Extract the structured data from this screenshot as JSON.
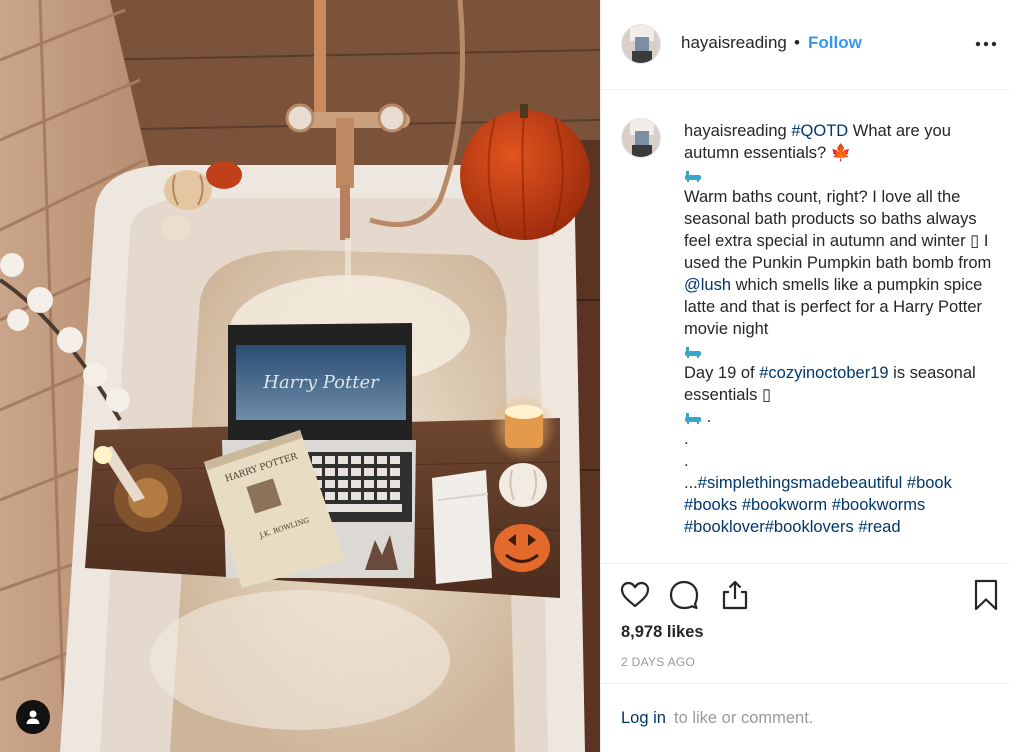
{
  "header": {
    "username": "hayaisreading",
    "separator": "•",
    "follow_label": "Follow"
  },
  "caption": {
    "username": "hayaisreading",
    "hashtag_qotd": "#QOTD",
    "question": " What are you autumn essentials? ",
    "leaf_emoji": "🍁",
    "paragraph_1": "Warm baths count, right? I love all the seasonal bath products so baths always feel extra special in autumn and winter ▯ I used the Punkin Pumpkin bath bomb from ",
    "mention": "@lush",
    "paragraph_1_end": " which smells like a pumpkin spice latte and that is perfect for a Harry Potter movie night",
    "day_prefix": "Day 19 of ",
    "hashtag_challenge": "#cozyinoctober19",
    "day_suffix": " is seasonal essentials ▯",
    "dot_after_tub": " .",
    "dot_line_1": ".",
    "dot_line_2": ".",
    "ellipsis": "...",
    "tags": [
      "#simplethingsmadebeautiful",
      "#book",
      "#books",
      "#bookworm",
      "#bookworms",
      "#booklover",
      "#booklovers",
      "#read"
    ]
  },
  "photo": {
    "book_title": "HARRY POTTER",
    "book_author": "J.K. ROWLING",
    "screen_title": "Harry Potter"
  },
  "actions": {
    "likes": "8,978 likes",
    "timestamp": "2 DAYS AGO"
  },
  "footer": {
    "login_label": "Log in",
    "login_suffix": "to like or comment."
  },
  "colors": {
    "link": "#00376b",
    "follow": "#3897f0",
    "muted": "#999999",
    "tub_icon": "#37a7c9"
  },
  "icons": [
    "user-tag-icon",
    "more-options-icon",
    "heart-icon",
    "comment-icon",
    "share-icon",
    "bookmark-icon",
    "bathtub-icon",
    "maple-leaf-icon"
  ]
}
